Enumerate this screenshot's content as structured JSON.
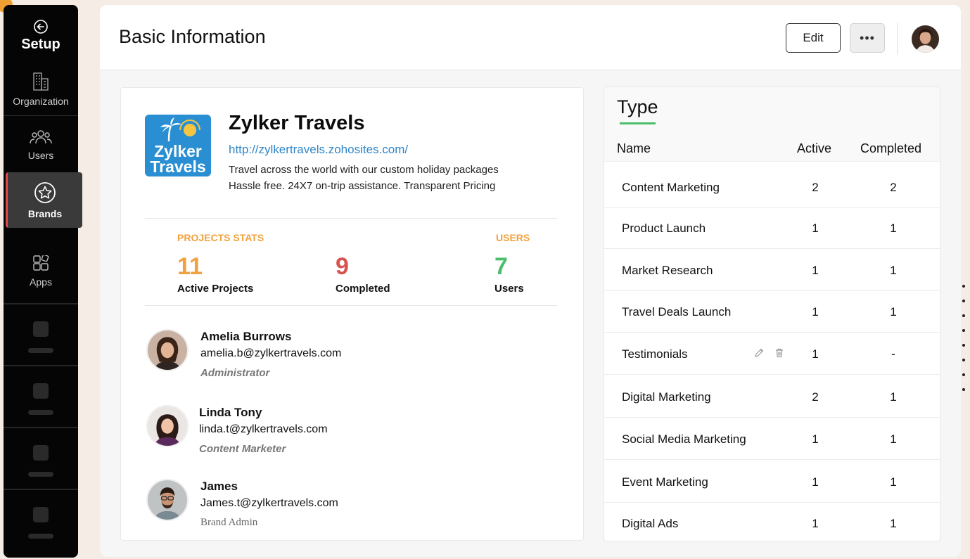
{
  "sidebar": {
    "setup_label": "Setup",
    "items": [
      {
        "label": "Organization",
        "icon": "building-icon"
      },
      {
        "label": "Users",
        "icon": "users-icon"
      },
      {
        "label": "Brands",
        "icon": "star-badge-icon",
        "active": true
      },
      {
        "label": "Apps",
        "icon": "apps-icon"
      }
    ],
    "accent_color": "#e04a4a"
  },
  "header": {
    "title": "Basic Information",
    "edit_label": "Edit",
    "more_label": "•••"
  },
  "brand": {
    "name": "Zylker Travels",
    "url": "http://zylkertravels.zohosites.com/",
    "description_line1": "Travel across the world with our custom holiday packages",
    "description_line2": "Hassle free. 24X7 on-trip assistance. Transparent Pricing",
    "logo_text_line1": "Zylker",
    "logo_text_line2": "Travels"
  },
  "stats": {
    "projects_heading": "PROJECTS STATS",
    "users_heading": "USERS",
    "active_projects": {
      "value": "11",
      "label": "Active Projects",
      "color": "#f0a23e"
    },
    "completed": {
      "value": "9",
      "label": "Completed",
      "color": "#d9534f"
    },
    "users": {
      "value": "7",
      "label": "Users",
      "color": "#4cbd6a"
    }
  },
  "members": [
    {
      "name": "Amelia Burrows",
      "email": "amelia.b@zylkertravels.com",
      "role": "Administrator"
    },
    {
      "name": "Linda Tony",
      "email": "linda.t@zylkertravels.com",
      "role": "Content Marketer"
    },
    {
      "name": "James",
      "email": "James.t@zylkertravels.com",
      "role": "Brand Admin"
    }
  ],
  "types": {
    "title": "Type",
    "columns": {
      "name": "Name",
      "active": "Active",
      "completed": "Completed"
    },
    "rows": [
      {
        "name": "Content Marketing",
        "active": "2",
        "completed": "2"
      },
      {
        "name": "Product Launch",
        "active": "1",
        "completed": "1"
      },
      {
        "name": "Market Research",
        "active": "1",
        "completed": "1"
      },
      {
        "name": "Travel Deals Launch",
        "active": "1",
        "completed": "1"
      },
      {
        "name": "Testimonials",
        "active": "1",
        "completed": "-"
      },
      {
        "name": "Digital Marketing",
        "active": "2",
        "completed": "1"
      },
      {
        "name": "Social Media Marketing",
        "active": "1",
        "completed": "1"
      },
      {
        "name": "Event Marketing",
        "active": "1",
        "completed": "1"
      },
      {
        "name": "Digital Ads",
        "active": "1",
        "completed": "1"
      }
    ]
  }
}
